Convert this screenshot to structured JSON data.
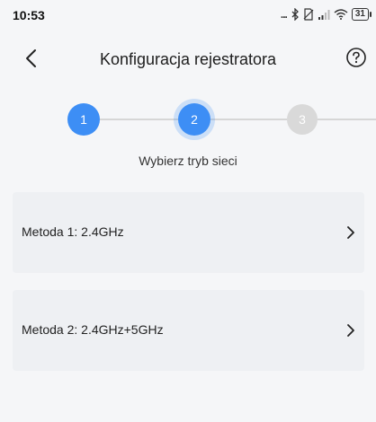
{
  "status_bar": {
    "time": "10:53",
    "dots": "...",
    "battery": "31",
    "icons": [
      "bluetooth-icon",
      "no-sim-icon",
      "signal-icon",
      "wifi-icon",
      "battery-icon"
    ]
  },
  "header": {
    "title": "Konfiguracja rejestratora",
    "back_icon": "back-arrow-icon",
    "help_icon": "help-circle-icon"
  },
  "stepper": {
    "steps": [
      {
        "number": "1",
        "state": "done"
      },
      {
        "number": "2",
        "state": "active"
      },
      {
        "number": "3",
        "state": "inactive"
      }
    ],
    "current_label": "Wybierz tryb sieci"
  },
  "methods": [
    {
      "label": "Metoda 1: 2.4GHz",
      "icon": "chevron-right-icon"
    },
    {
      "label": "Metoda 2: 2.4GHz+5GHz",
      "icon": "chevron-right-icon"
    }
  ],
  "colors": {
    "accent": "#3d8ef5",
    "inactive": "#d9d9d9",
    "card": "#eef0f3",
    "background": "#f5f6f8"
  }
}
